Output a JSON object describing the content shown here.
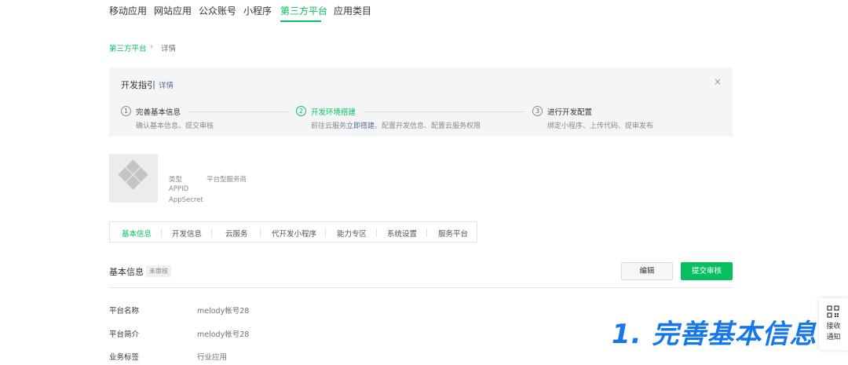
{
  "topnav": {
    "tabs": [
      {
        "label": "移动应用"
      },
      {
        "label": "网站应用"
      },
      {
        "label": "公众账号"
      },
      {
        "label": "小程序"
      },
      {
        "label": "第三方平台"
      },
      {
        "label": "应用类目"
      }
    ],
    "active_index": 4
  },
  "breadcrumb": {
    "parent": "第三方平台",
    "separator": "›",
    "current": "详情"
  },
  "guide": {
    "title": "开发指引",
    "link": "详情",
    "close": "×",
    "steps": [
      {
        "num": "1",
        "title": "完善基本信息",
        "desc": "确认基本信息、提交审核"
      },
      {
        "num": "2",
        "title": "开发环境搭建",
        "desc_pre": "前往云服务",
        "desc_link": "立即搭建",
        "desc_post": "、配置开发信息、配置云服务权限"
      },
      {
        "num": "3",
        "title": "进行开发配置",
        "desc": "绑定小程序、上传代码、提审发布"
      }
    ]
  },
  "profile": {
    "type_label": "类型",
    "type_value": "平台型服务商",
    "appid_label": "APPID",
    "secret_label": "AppSecret"
  },
  "subtabs": [
    {
      "label": "基本信息"
    },
    {
      "label": "开发信息"
    },
    {
      "label": "云服务"
    },
    {
      "label": "代开发小程序"
    },
    {
      "label": "能力专区"
    },
    {
      "label": "系统设置"
    },
    {
      "label": "服务平台"
    }
  ],
  "basic_info": {
    "title": "基本信息",
    "status": "未审核",
    "edit_label": "编辑",
    "submit_label": "提交审核",
    "fields": [
      {
        "label": "平台名称",
        "value": "melody帐号28"
      },
      {
        "label": "平台简介",
        "value": "melody帐号28"
      },
      {
        "label": "业务标签",
        "value": "行业应用"
      }
    ]
  },
  "overlay": {
    "text": "1. 完善基本信息"
  },
  "float_panel": {
    "icon": "qrcode-icon",
    "line1": "接收",
    "line2": "通知"
  },
  "colors": {
    "accent": "#07c160",
    "link": "#576b95",
    "overlay": "#1677e8"
  }
}
